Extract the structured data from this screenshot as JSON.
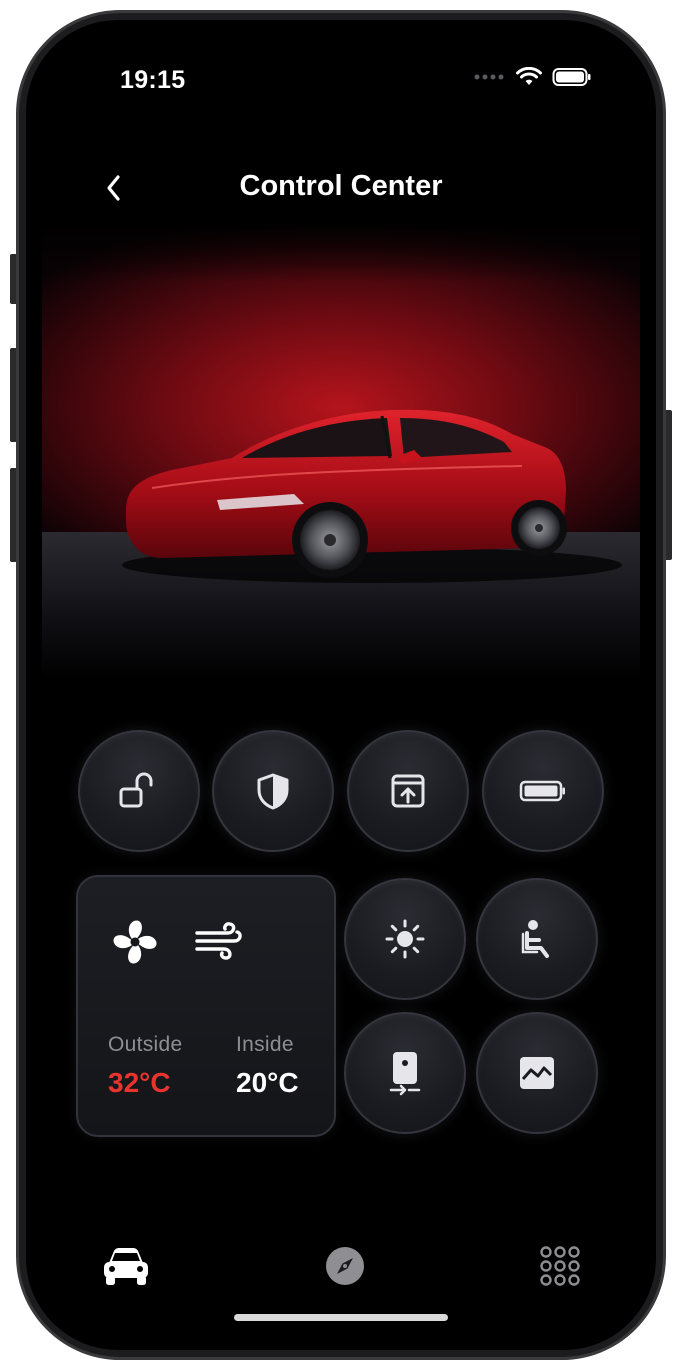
{
  "status": {
    "time": "19:15"
  },
  "nav": {
    "title": "Control Center"
  },
  "controls": {
    "row1": [
      {
        "name": "lock",
        "icon": "unlock-icon"
      },
      {
        "name": "security",
        "icon": "shield-icon"
      },
      {
        "name": "trunk",
        "icon": "trunk-open-icon"
      },
      {
        "name": "battery",
        "icon": "battery-icon"
      }
    ],
    "grid": [
      {
        "name": "lights",
        "icon": "sun-icon"
      },
      {
        "name": "seat",
        "icon": "seat-icon"
      },
      {
        "name": "phone-key",
        "icon": "phone-key-icon"
      },
      {
        "name": "gallery",
        "icon": "image-icon"
      }
    ]
  },
  "climate": {
    "icons": [
      "fan-icon",
      "wind-icon"
    ],
    "outside_label": "Outside",
    "outside_value": "32°C",
    "inside_label": "Inside",
    "inside_value": "20°C",
    "outside_color": "#e8332e",
    "inside_color": "#ffffff"
  },
  "tabbar": [
    "car-icon",
    "compass-icon",
    "grid-icon"
  ]
}
